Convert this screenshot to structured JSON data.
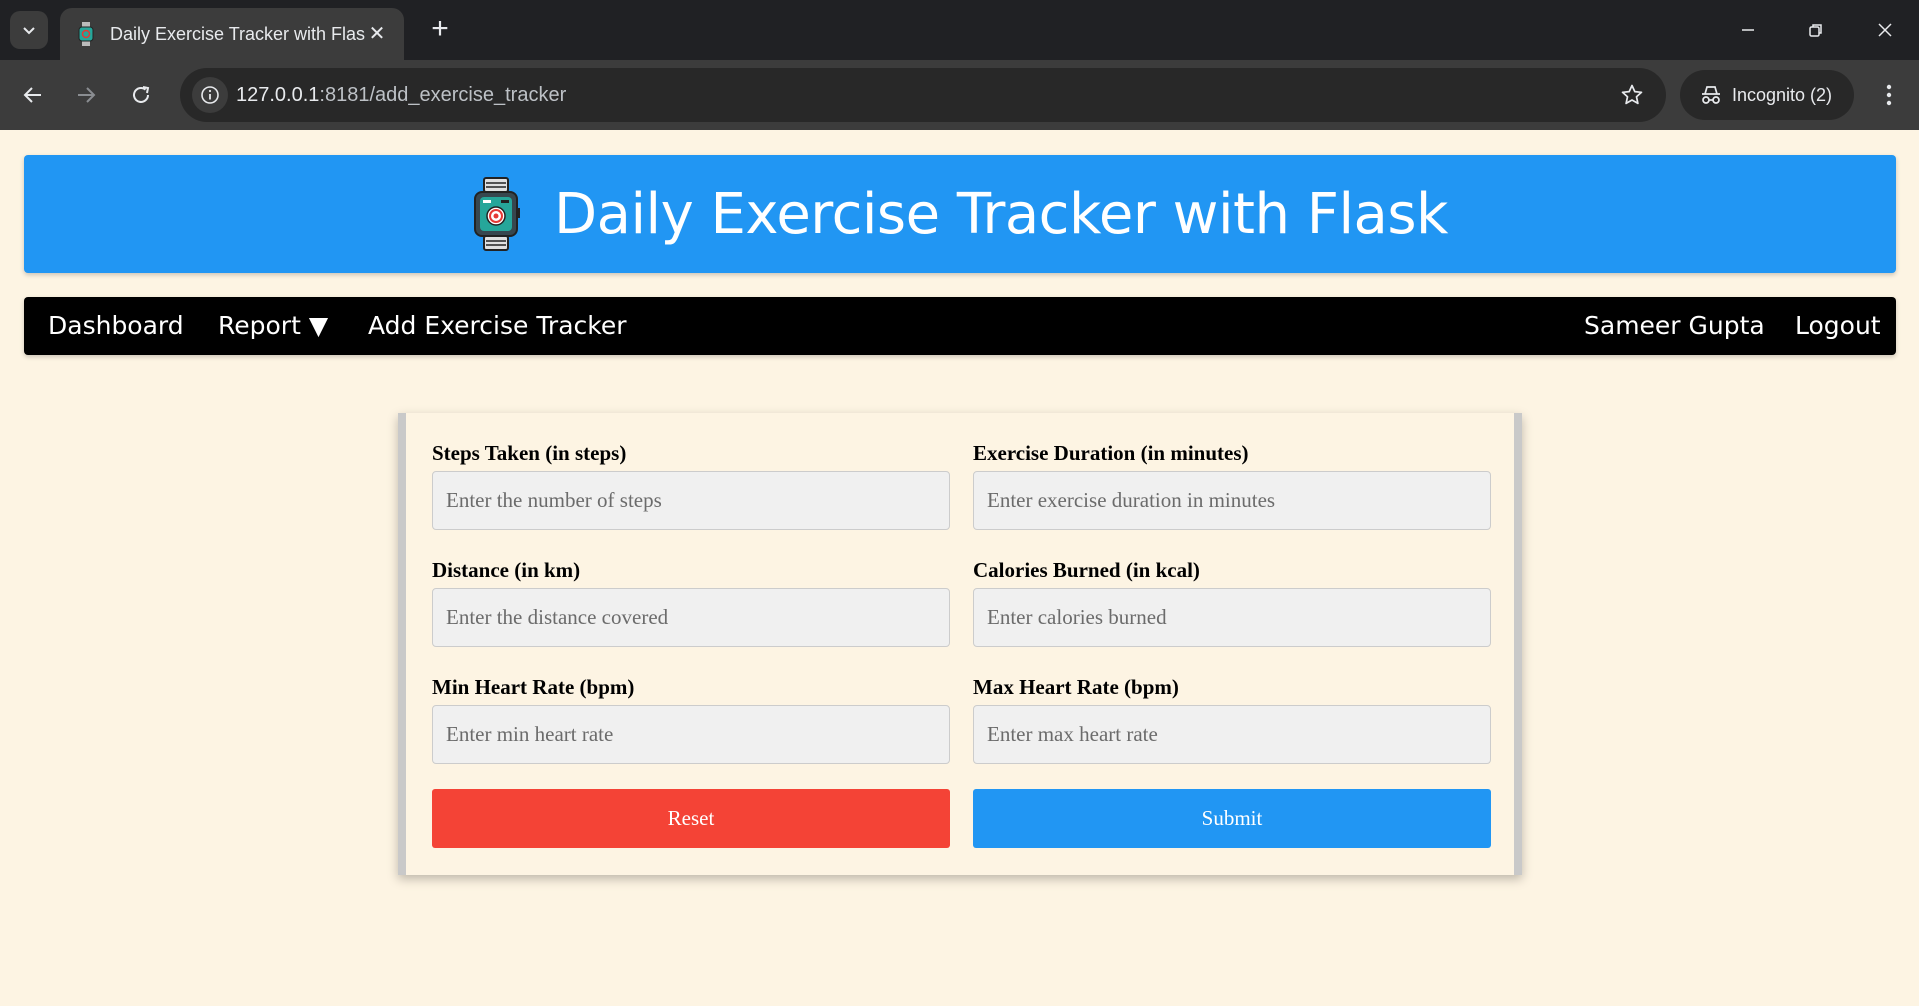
{
  "browser": {
    "tab_title": "Daily Exercise Tracker with Flask",
    "tab_close": "✕",
    "new_tab": "+",
    "url_host": "127.0.0.1",
    "url_path": ":8181/add_exercise_tracker",
    "incognito_label": "Incognito (2)"
  },
  "header": {
    "title": "Daily Exercise Tracker with Flask"
  },
  "nav": {
    "dashboard": "Dashboard",
    "report": "Report ▼",
    "add_tracker": "Add Exercise Tracker",
    "user_name": "Sameer Gupta",
    "logout": "Logout"
  },
  "form": {
    "steps": {
      "label": "Steps Taken (in steps)",
      "placeholder": "Enter the number of steps",
      "value": ""
    },
    "duration": {
      "label": "Exercise Duration (in minutes)",
      "placeholder": "Enter exercise duration in minutes",
      "value": ""
    },
    "distance": {
      "label": "Distance (in km)",
      "placeholder": "Enter the distance covered",
      "value": ""
    },
    "calories": {
      "label": "Calories Burned (in kcal)",
      "placeholder": "Enter calories burned",
      "value": ""
    },
    "min_hr": {
      "label": "Min Heart Rate (bpm)",
      "placeholder": "Enter min heart rate",
      "value": ""
    },
    "max_hr": {
      "label": "Max Heart Rate (bpm)",
      "placeholder": "Enter max heart rate",
      "value": ""
    },
    "reset_label": "Reset",
    "submit_label": "Submit"
  },
  "colors": {
    "banner": "#2196f3",
    "navbar": "#000000",
    "page_bg": "#fdf4e3",
    "reset": "#f44336",
    "submit": "#2196f3"
  },
  "icons": {
    "tab_search": "chevron-down-icon",
    "favicon": "smartwatch-icon",
    "back": "arrow-left-icon",
    "forward": "arrow-right-icon",
    "reload": "reload-icon",
    "site_info": "info-icon",
    "bookmark": "star-icon",
    "incognito": "incognito-icon",
    "menu": "more-vertical-icon",
    "banner_logo": "smartwatch-icon"
  }
}
